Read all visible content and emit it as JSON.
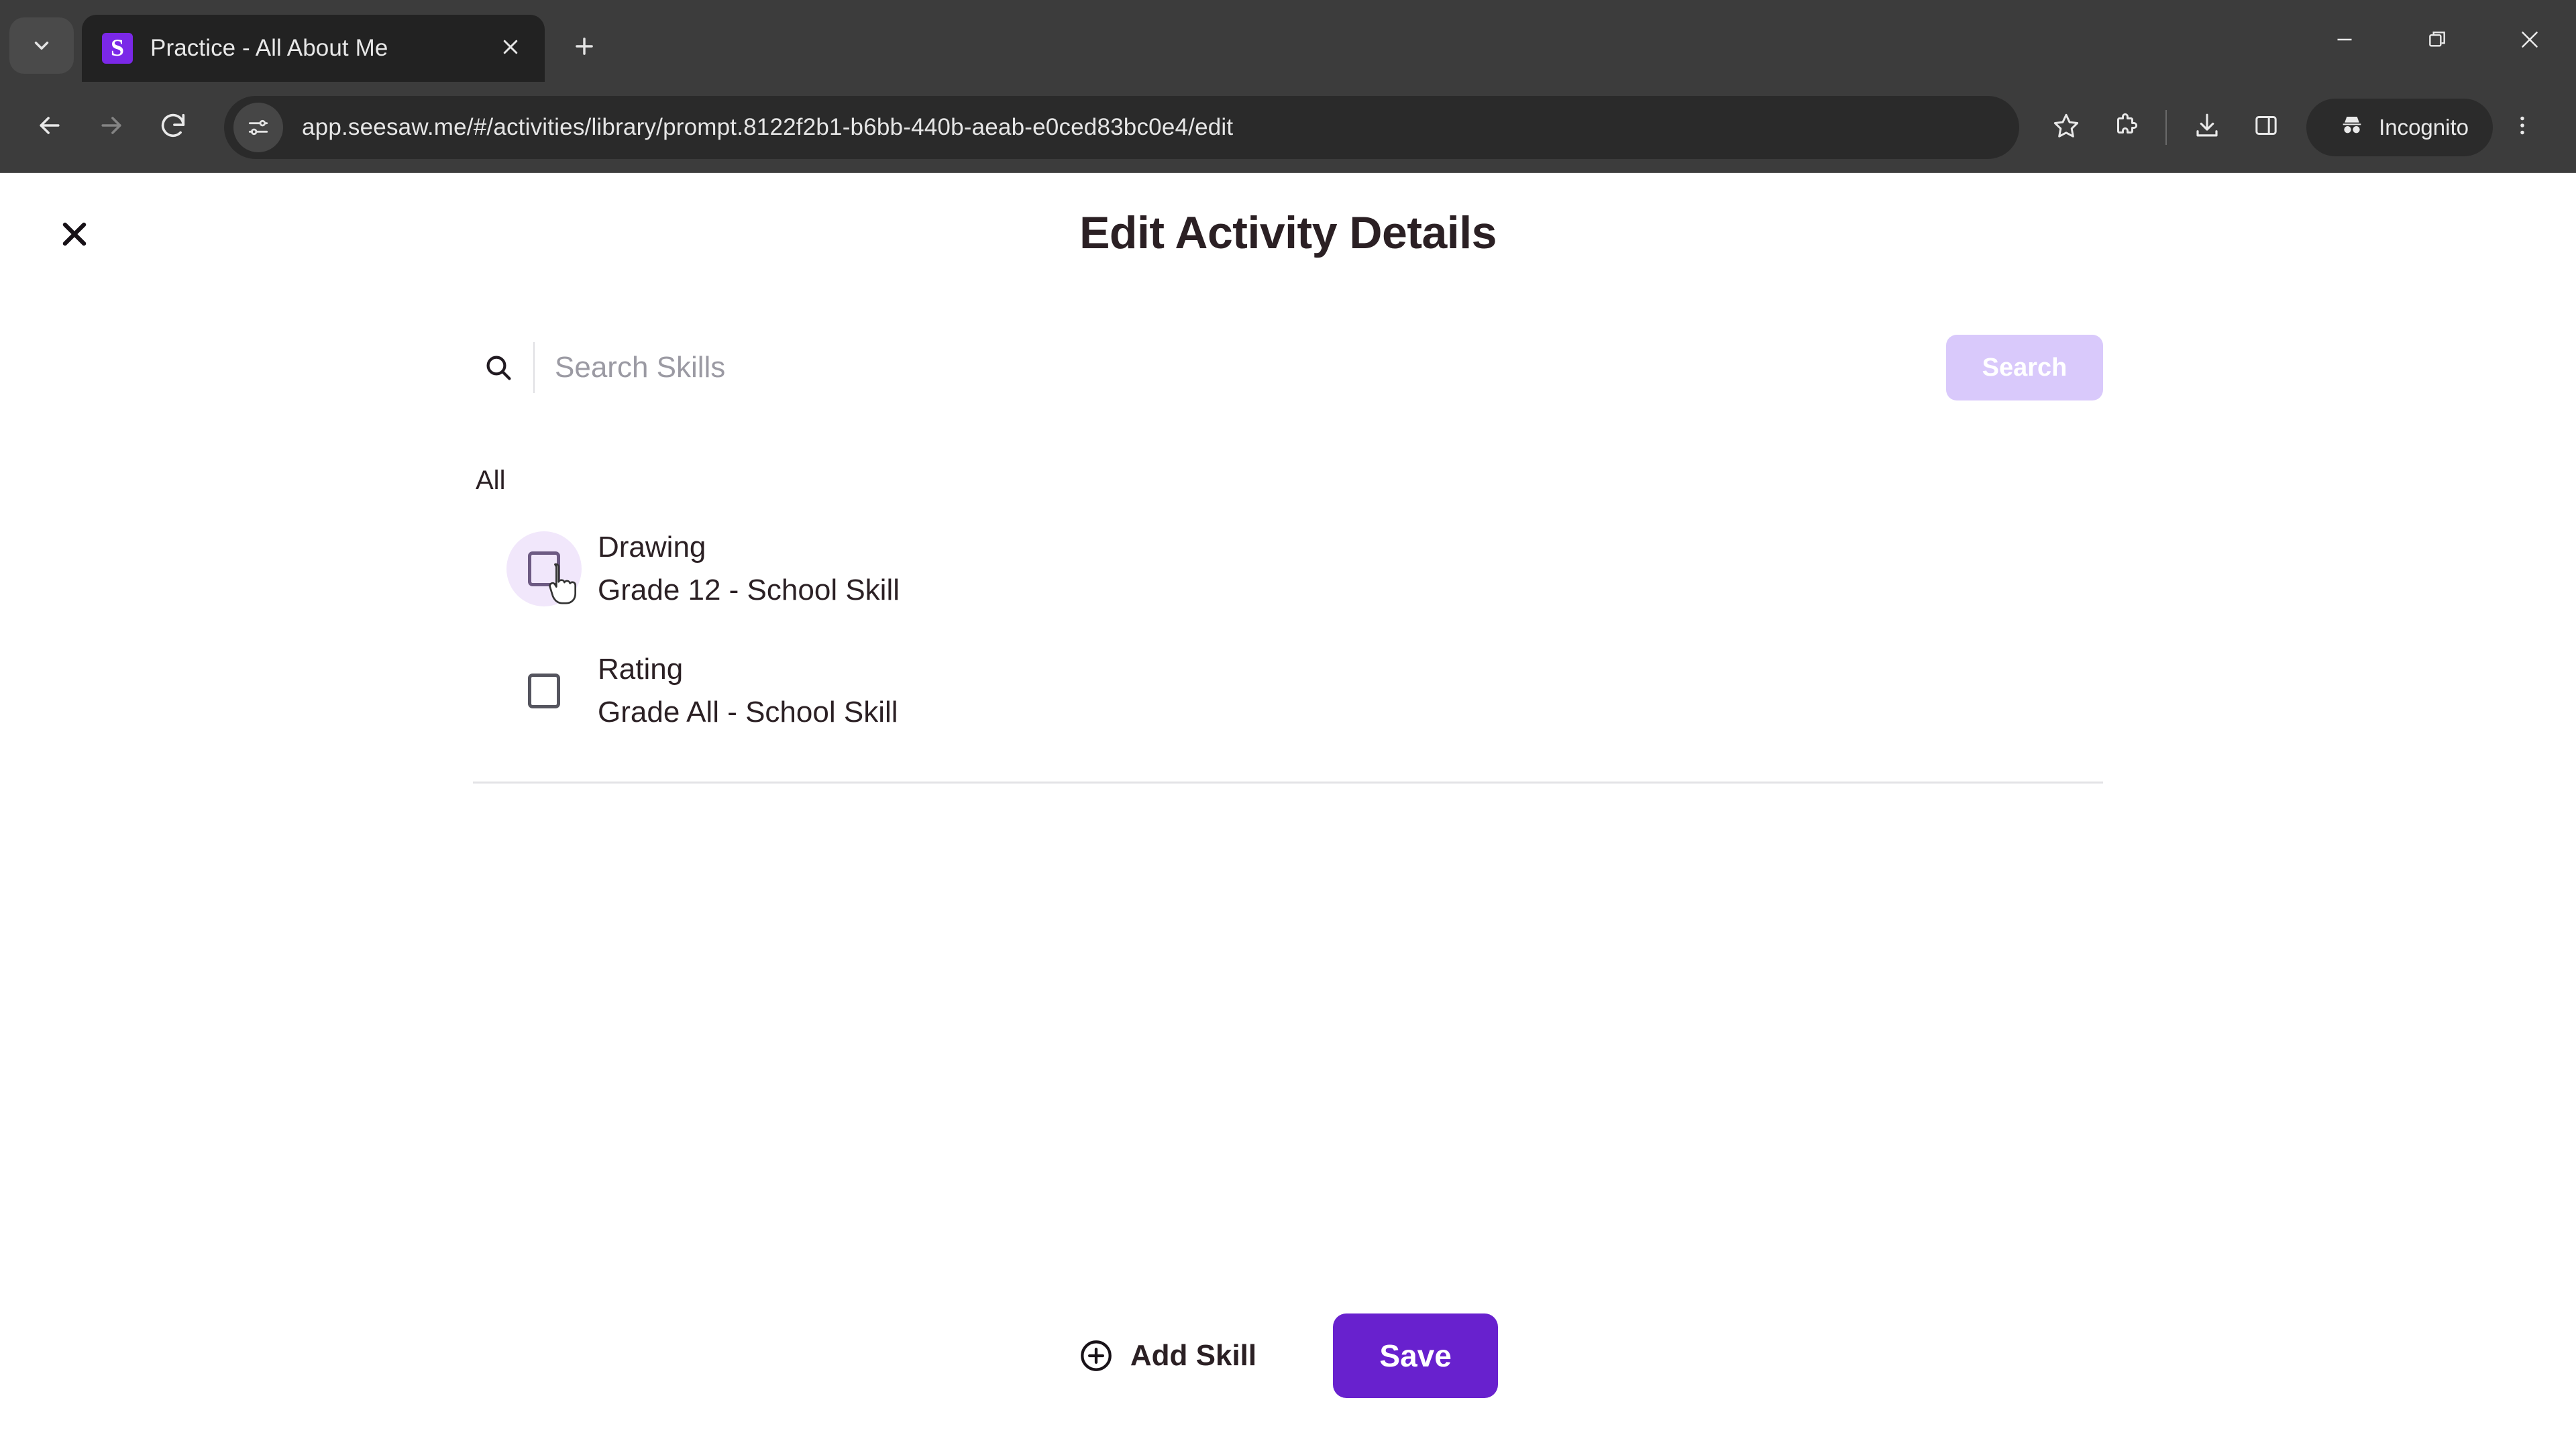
{
  "browser": {
    "tab_search_icon": "chevron-down-icon",
    "tab": {
      "title": "Practice - All About Me",
      "favicon_letter": "S",
      "favicon_color": "#7b28e8",
      "close_icon": "close-icon"
    },
    "new_tab_icon": "plus-icon",
    "window_controls": {
      "minimize": "minimize-icon",
      "maximize": "maximize-icon",
      "close": "close-icon"
    },
    "toolbar": {
      "back_icon": "back-arrow-icon",
      "forward_icon": "forward-arrow-icon",
      "reload_icon": "reload-icon",
      "site_info_icon": "site-settings-icon",
      "url": "app.seesaw.me/#/activities/library/prompt.8122f2b1-b6bb-440b-aeab-e0ced83bc0e4/edit",
      "bookmark_icon": "star-icon",
      "extensions_icon": "extensions-puzzle-icon",
      "downloads_icon": "download-icon",
      "side_panel_icon": "side-panel-icon",
      "incognito_icon": "incognito-icon",
      "incognito_label": "Incognito",
      "menu_icon": "three-dot-menu-icon"
    }
  },
  "page": {
    "close_icon": "close-icon",
    "title": "Edit Activity Details",
    "search": {
      "icon": "search-icon",
      "placeholder": "Search Skills",
      "value": "",
      "button_label": "Search",
      "button_color": "#d9c9fb",
      "button_disabled": true
    },
    "group_label": "All",
    "skills": [
      {
        "name": "Drawing",
        "meta": "Grade 12 - School Skill",
        "checked": false,
        "hovered": true
      },
      {
        "name": "Rating",
        "meta": "Grade All - School Skill",
        "checked": false,
        "hovered": false
      }
    ],
    "footer": {
      "add_skill_icon": "plus-circle-icon",
      "add_skill_label": "Add Skill",
      "save_label": "Save",
      "save_color": "#6821ce"
    }
  }
}
